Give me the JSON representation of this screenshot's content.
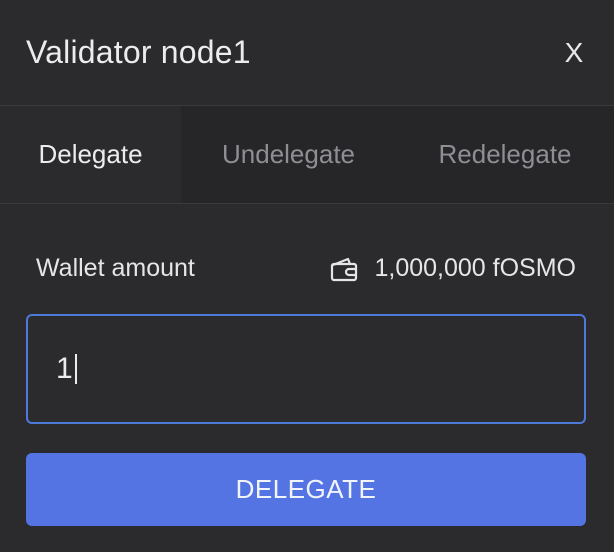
{
  "modal": {
    "title": "Validator node1",
    "close_label": "X"
  },
  "tabs": [
    {
      "label": "Delegate",
      "active": true
    },
    {
      "label": "Undelegate",
      "active": false
    },
    {
      "label": "Redelegate",
      "active": false
    }
  ],
  "wallet": {
    "label": "Wallet amount",
    "icon": "wallet-icon",
    "balance": "1,000,000 fOSMO"
  },
  "amount_input": {
    "value": "1"
  },
  "submit": {
    "label": "DELEGATE"
  },
  "colors": {
    "background": "#2b2b2e",
    "accent": "#5474e4",
    "input_border": "#4d79d8"
  }
}
